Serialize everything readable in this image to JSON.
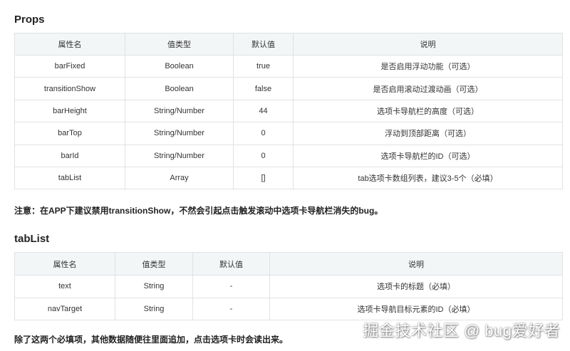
{
  "props": {
    "title": "Props",
    "headers": [
      "属性名",
      "值类型",
      "默认值",
      "说明"
    ],
    "rows": [
      [
        "barFixed",
        "Boolean",
        "true",
        "是否启用浮动功能（可选）"
      ],
      [
        "transitionShow",
        "Boolean",
        "false",
        "是否启用滚动过渡动画（可选）"
      ],
      [
        "barHeight",
        "String/Number",
        "44",
        "选项卡导航栏的高度（可选）"
      ],
      [
        "barTop",
        "String/Number",
        "0",
        "浮动到顶部距离（可选）"
      ],
      [
        "barId",
        "String/Number",
        "0",
        "选项卡导航栏的ID（可选）"
      ],
      [
        "tabList",
        "Array",
        "[]",
        "tab选项卡数组列表，建议3-5个（必填）"
      ]
    ]
  },
  "note1": "注意：在APP下建议禁用transitionShow，不然会引起点击触发滚动中选项卡导航栏消失的bug。",
  "tablist": {
    "title": "tabList",
    "headers": [
      "属性名",
      "值类型",
      "默认值",
      "说明"
    ],
    "rows": [
      [
        "text",
        "String",
        "-",
        "选项卡的标题（必填）"
      ],
      [
        "navTarget",
        "String",
        "-",
        "选项卡导航目标元素的ID（必填）"
      ]
    ]
  },
  "note2": "除了这两个必填项，其他数据随便往里面追加，点击选项卡时会读出来。",
  "watermark": "掘金技术社区 @ bug爱好者"
}
